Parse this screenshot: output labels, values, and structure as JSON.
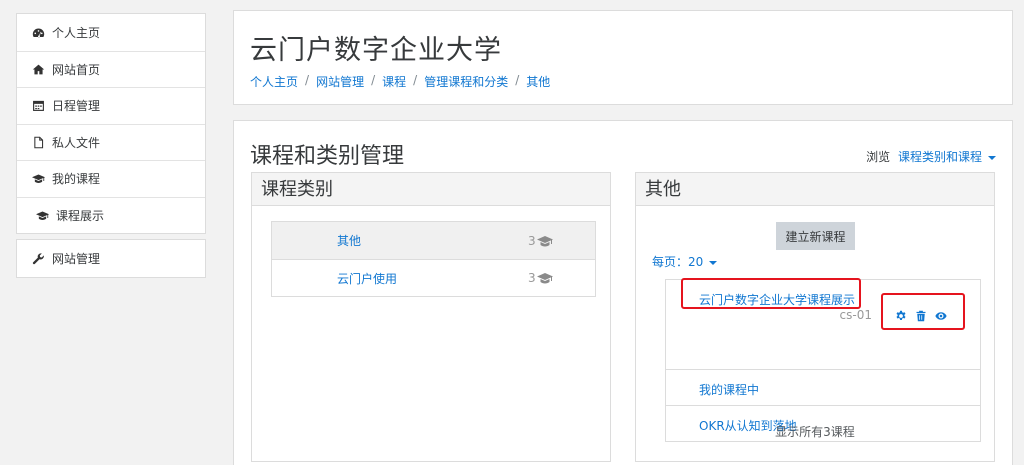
{
  "sidebar": {
    "group1": [
      {
        "label": "个人主页",
        "icon": "dashboard-icon"
      },
      {
        "label": "网站首页",
        "icon": "home-icon"
      },
      {
        "label": "日程管理",
        "icon": "calendar-icon"
      },
      {
        "label": "私人文件",
        "icon": "file-icon"
      },
      {
        "label": "我的课程",
        "icon": "graduation-cap-icon"
      },
      {
        "label": "课程展示",
        "icon": "graduation-cap-icon"
      }
    ],
    "group2": [
      {
        "label": "网站管理",
        "icon": "wrench-icon"
      }
    ]
  },
  "header": {
    "site_title": "云门户数字企业大学",
    "breadcrumb": [
      "个人主页",
      "网站管理",
      "课程",
      "管理课程和分类",
      "其他"
    ],
    "separator": "/"
  },
  "main": {
    "heading": "课程和类别管理",
    "view_label": "浏览",
    "view_value": "课程类别和课程"
  },
  "categories_panel": {
    "title": "课程类别",
    "rows": [
      {
        "name": "其他",
        "count": "3"
      },
      {
        "name": "云门户使用",
        "count": "3"
      }
    ]
  },
  "other_panel": {
    "title": "其他",
    "new_course_button": "建立新课程",
    "per_page_label": "每页：",
    "per_page_value": "20",
    "courses": [
      {
        "name": "云门户数字企业大学课程展示",
        "idnumber": "cs-01"
      },
      {
        "name": "我的课程中",
        "idnumber": ""
      },
      {
        "name": "OKR从认知到落地",
        "idnumber": ""
      }
    ],
    "show_all": "显示所有3课程"
  },
  "colors": {
    "link": "#1177d1",
    "highlight": "#e5141e",
    "panel_head_bg": "#f4f4f4"
  }
}
